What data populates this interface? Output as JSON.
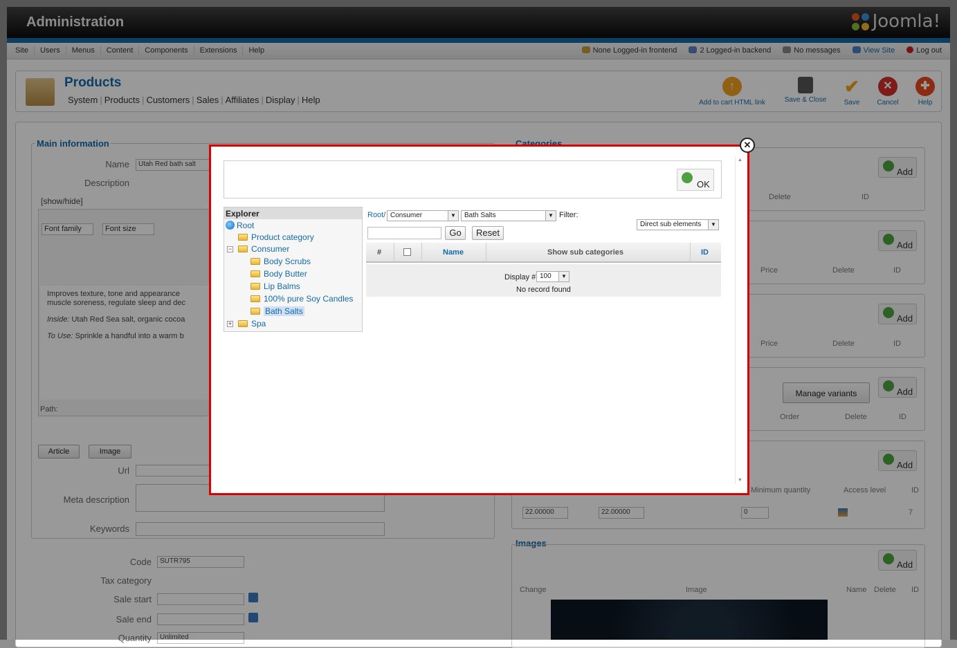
{
  "header": {
    "title": "Administration",
    "logo_text": "Joomla!"
  },
  "menu": [
    "Site",
    "Users",
    "Menus",
    "Content",
    "Components",
    "Extensions",
    "Help"
  ],
  "status": [
    "None Logged-in frontend",
    "2 Logged-in backend",
    "No messages",
    "View Site",
    "Log out"
  ],
  "page": {
    "title": "Products",
    "submenu": [
      "System",
      "Products",
      "Customers",
      "Sales",
      "Affiliates",
      "Display",
      "Help"
    ]
  },
  "toolbar": {
    "add_to_cart": "Add to cart HTML link",
    "save_close": "Save & Close",
    "save": "Save",
    "cancel": "Cancel",
    "help": "Help"
  },
  "main_info": {
    "legend": "Main information",
    "name_label": "Name",
    "name_value": "Utah Red bath salt",
    "description_label": "Description",
    "showhide": "[show/hide]",
    "font_family": "Font family",
    "font_size": "Font size",
    "desc_line1": "Improves texture, tone and appearance",
    "desc_line2": "muscle soreness, regulate sleep and dec",
    "desc_inside_label": "Inside:",
    "desc_inside": "Utah Red Sea salt, organic cocoa",
    "desc_use_label": "To Use:",
    "desc_use": "Sprinkle a handful into a warm b",
    "path_label": "Path:",
    "article_btn": "Article",
    "image_btn": "Image",
    "url_label": "Url",
    "meta_label": "Meta description",
    "keywords_label": "Keywords"
  },
  "details": {
    "code_label": "Code",
    "code_value": "SUTR795",
    "tax_label": "Tax category",
    "sale_start_label": "Sale start",
    "sale_end_label": "Sale end",
    "quantity_label": "Quantity",
    "quantity_value": "Unlimited"
  },
  "right": {
    "categories_legend": "Categories",
    "add": "Add",
    "delete": "Delete",
    "id": "ID",
    "price": "Price",
    "order": "Order",
    "manage_variants": "Manage variants",
    "min_qty": "Minimum quantity",
    "access_level": "Access level",
    "price1": "22.00000",
    "price2": "22.00000",
    "qty0": "0",
    "row_id": "7",
    "images_legend": "Images",
    "change": "Change",
    "image": "Image",
    "name": "Name"
  },
  "modal": {
    "ok": "OK",
    "explorer": "Explorer",
    "tree": {
      "root": "Root",
      "product_category": "Product category",
      "consumer": "Consumer",
      "body_scrubs": "Body Scrubs",
      "body_butter": "Body Butter",
      "lip_balms": "Lip Balms",
      "soy_candles": "100% pure Soy Candles",
      "bath_salts": "Bath Salts",
      "spa": "Spa"
    },
    "breadcrumb_root": "Root/",
    "select1": "Consumer",
    "select2": "Bath Salts",
    "filter_label": "Filter:",
    "filter_select": "Direct sub elements",
    "search_value": "",
    "go": "Go",
    "reset": "Reset",
    "columns": {
      "num": "#",
      "name": "Name",
      "sub": "Show sub categories",
      "id": "ID"
    },
    "display_label": "Display #",
    "display_value": "100",
    "no_record": "No record found"
  }
}
